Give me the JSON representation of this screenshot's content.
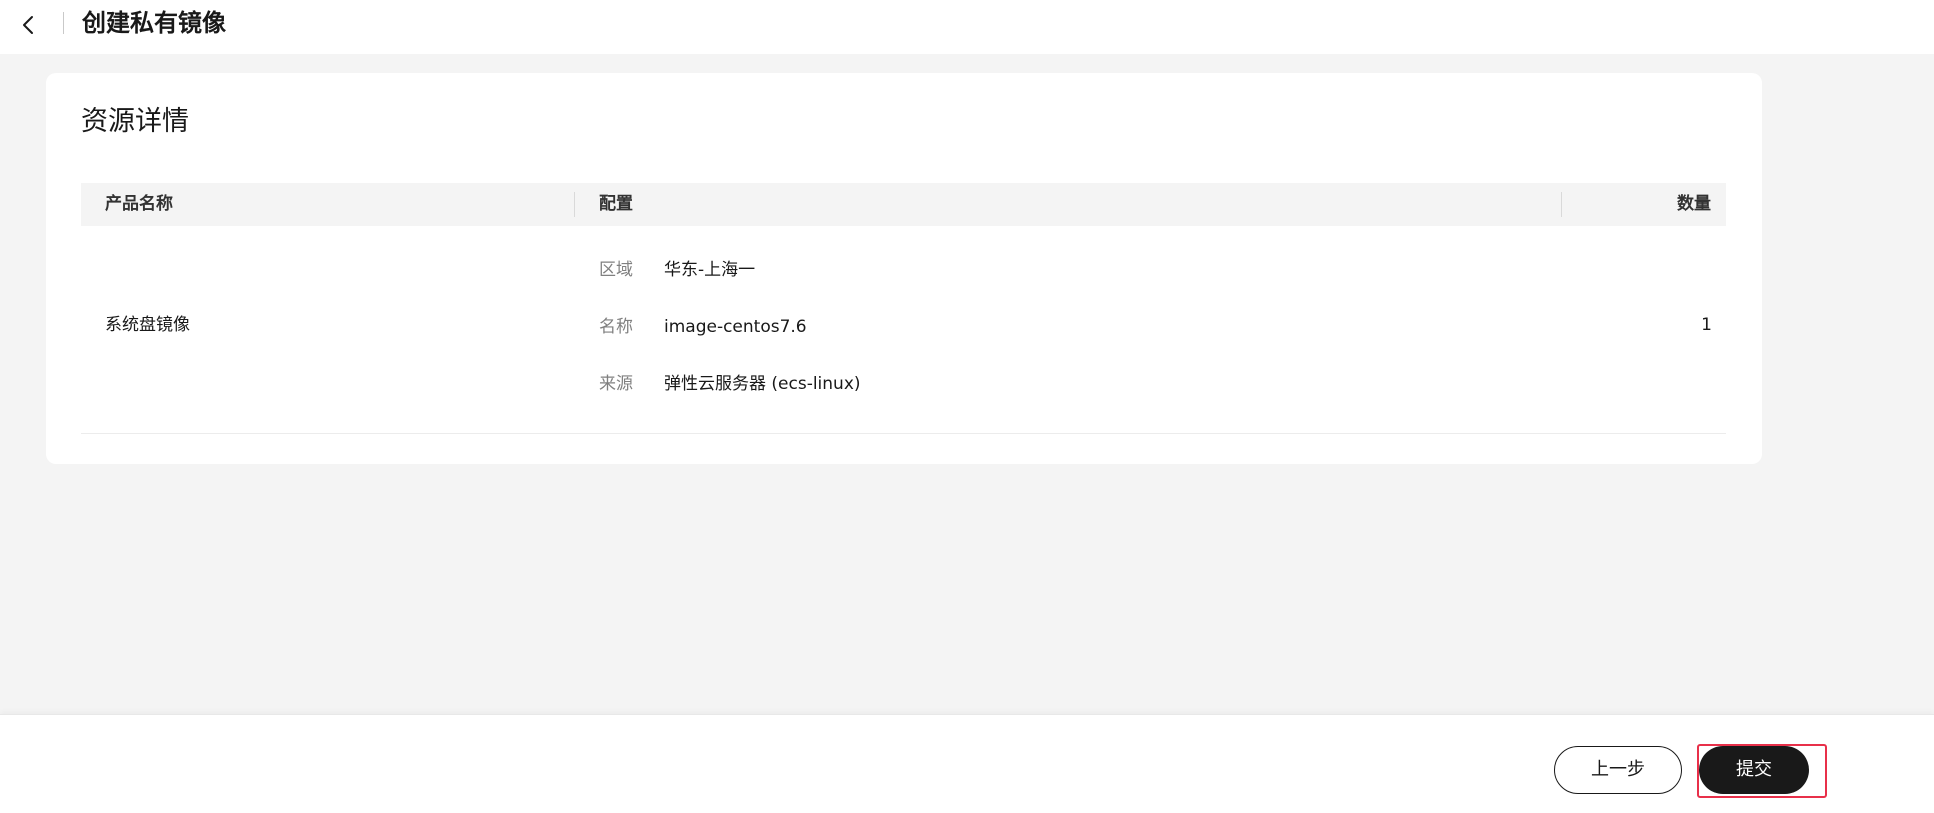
{
  "header": {
    "title": "创建私有镜像"
  },
  "card": {
    "title": "资源详情",
    "columns": {
      "product": "产品名称",
      "config": "配置",
      "quantity": "数量"
    },
    "row": {
      "product": "系统盘镜像",
      "quantity": "1",
      "config": [
        {
          "label": "区域",
          "value": "华东-上海一"
        },
        {
          "label": "名称",
          "value": "image-centos7.6"
        },
        {
          "label": "来源",
          "value": "弹性云服务器 (ecs-linux)"
        }
      ]
    }
  },
  "footer": {
    "prev_label": "上一步",
    "submit_label": "提交"
  },
  "colors": {
    "primary_button": "#191919",
    "highlight_border": "#e8304a",
    "background": "#f4f4f4"
  }
}
